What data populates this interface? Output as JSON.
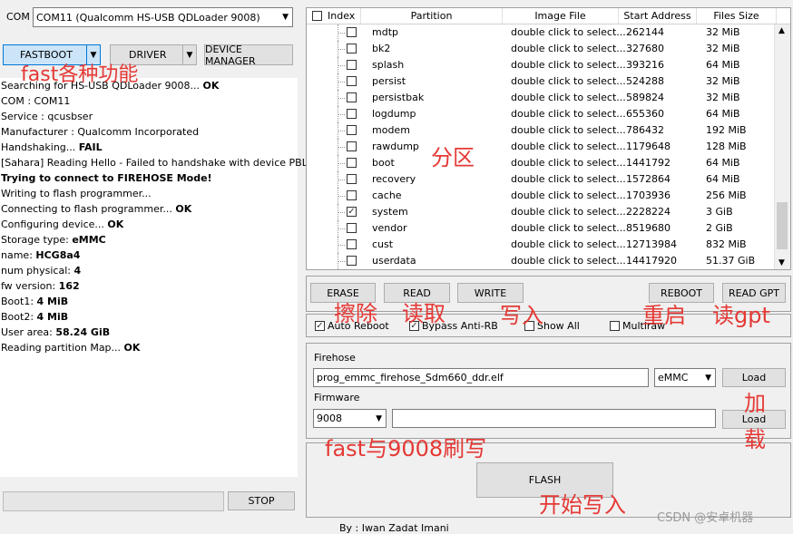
{
  "com": {
    "label": "COM",
    "port": "COM11 (Qualcomm HS-USB QDLoader 9008)"
  },
  "left_buttons": {
    "fastboot": "FASTBOOT",
    "driver": "DRIVER",
    "device_manager": "DEVICE MANAGER"
  },
  "log": [
    {
      "text": "Searching for HS-USB QDLoader 9008... ",
      "bold": "OK"
    },
    {
      "text": "  COM : COM11",
      "bold": ""
    },
    {
      "text": "  Service : qcusbser",
      "bold": ""
    },
    {
      "text": "  Manufacturer : Qualcomm Incorporated",
      "bold": ""
    },
    {
      "text": "Handshaking... ",
      "bold": "FAIL"
    },
    {
      "text": "[Sahara] Reading Hello - Failed to handshake with device PBL!",
      "bold": ""
    },
    {
      "text": "",
      "bold": "Trying to connect to FIREHOSE Mode!"
    },
    {
      "text": "Writing to flash programmer...",
      "bold": ""
    },
    {
      "text": "Connecting to flash programmer... ",
      "bold": "OK"
    },
    {
      "text": "Configuring device... ",
      "bold": "OK"
    },
    {
      "text": " Storage type: ",
      "bold": "eMMC"
    },
    {
      "text": " name: ",
      "bold": "HCG8a4"
    },
    {
      "text": " num physical: ",
      "bold": "4"
    },
    {
      "text": " fw version: ",
      "bold": "162"
    },
    {
      "text": " Boot1: ",
      "bold": "4 MiB"
    },
    {
      "text": " Boot2: ",
      "bold": "4 MiB"
    },
    {
      "text": "User area: ",
      "bold": "58.24 GiB"
    },
    {
      "text": "Reading partition Map... ",
      "bold": "OK"
    }
  ],
  "stop_label": "STOP",
  "table": {
    "headers": [
      "Index",
      "Partition",
      "Image File",
      "Start Address",
      "Files Size"
    ],
    "rows": [
      {
        "name": "mdtp",
        "image": "double click to select...",
        "start": "262144",
        "size": "32 MiB",
        "checked": false
      },
      {
        "name": "bk2",
        "image": "double click to select...",
        "start": "327680",
        "size": "32 MiB",
        "checked": false
      },
      {
        "name": "splash",
        "image": "double click to select...",
        "start": "393216",
        "size": "64 MiB",
        "checked": false
      },
      {
        "name": "persist",
        "image": "double click to select...",
        "start": "524288",
        "size": "32 MiB",
        "checked": false
      },
      {
        "name": "persistbak",
        "image": "double click to select...",
        "start": "589824",
        "size": "32 MiB",
        "checked": false
      },
      {
        "name": "logdump",
        "image": "double click to select...",
        "start": "655360",
        "size": "64 MiB",
        "checked": false
      },
      {
        "name": "modem",
        "image": "double click to select...",
        "start": "786432",
        "size": "192 MiB",
        "checked": false
      },
      {
        "name": "rawdump",
        "image": "double click to select...",
        "start": "1179648",
        "size": "128 MiB",
        "checked": false
      },
      {
        "name": "boot",
        "image": "double click to select...",
        "start": "1441792",
        "size": "64 MiB",
        "checked": false
      },
      {
        "name": "recovery",
        "image": "double click to select...",
        "start": "1572864",
        "size": "64 MiB",
        "checked": false
      },
      {
        "name": "cache",
        "image": "double click to select...",
        "start": "1703936",
        "size": "256 MiB",
        "checked": false
      },
      {
        "name": "system",
        "image": "double click to select...",
        "start": "2228224",
        "size": "3 GiB",
        "checked": true
      },
      {
        "name": "vendor",
        "image": "double click to select...",
        "start": "8519680",
        "size": "2 GiB",
        "checked": false
      },
      {
        "name": "cust",
        "image": "double click to select...",
        "start": "12713984",
        "size": "832 MiB",
        "checked": false
      },
      {
        "name": "userdata",
        "image": "double click to select...",
        "start": "14417920",
        "size": "51.37 GiB",
        "checked": false
      }
    ]
  },
  "actions": {
    "erase": "ERASE",
    "read": "READ",
    "write": "WRITE",
    "reboot": "REBOOT",
    "read_gpt": "READ GPT"
  },
  "options": {
    "auto_reboot": "Auto Reboot",
    "bypass": "Bypass Anti-RB",
    "show_all": "Show All",
    "multiraw": "Multiraw"
  },
  "firehose": {
    "label": "Firehose",
    "file": "prog_emmc_firehose_Sdm660_ddr.elf",
    "storage": "eMMC",
    "load": "Load"
  },
  "firmware": {
    "label": "Firmware",
    "mode": "9008",
    "load": "Load"
  },
  "flash_label": "FLASH",
  "footer": "By : Iwan Zadat Imani",
  "watermark": "CSDN @安卓机器",
  "annotations": {
    "fast": "fast各种功能",
    "partition": "分区",
    "erase": "擦除",
    "read": "读取",
    "write": "写入",
    "reboot": "重启",
    "read_gpt": "读gpt",
    "load1": "加",
    "load2": "载",
    "fast9008": "fast与9008刷写",
    "start": "开始写入"
  },
  "colors": {
    "annotation": "#e53935",
    "selected_btn": "#cce4f7"
  }
}
